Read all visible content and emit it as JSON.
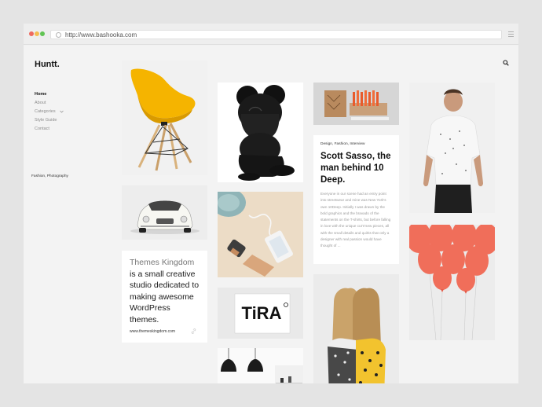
{
  "browser": {
    "url": "http://www.bashooka.com"
  },
  "site": {
    "logo": "Huntt."
  },
  "nav": {
    "items": [
      {
        "label": "Home"
      },
      {
        "label": "About"
      },
      {
        "label": "Categories"
      },
      {
        "label": "Style Guide"
      },
      {
        "label": "Contact"
      }
    ]
  },
  "themes_card": {
    "brand": "Themes Kingdom",
    "text": " is a small creative studio dedicated to making awesome WordPress themes.",
    "link": "www.themeskingdom.com"
  },
  "tira": {
    "logo": "TiRA"
  },
  "post": {
    "tags": "Design, Fashion, Interview",
    "title": "Scott Sasso, the man behind 10 Deep.",
    "excerpt": "Everyone in our scene had an entry point into streetwear and mine was New York's own 10Deep. Initially I was drawn by the bold graphics and the bravado of the statements on the T-shirts, but before falling in love with the unique cut'n'sew pieces, all with the small details and quirks that only a designer with real passion would have thought of ..."
  },
  "photo_post": {
    "tags": "Fashion, Photography"
  },
  "colors": {
    "accent_chair": "#f5b400",
    "balloons": "#f06e5a"
  },
  "icons": [
    "search-icon",
    "menu-icon",
    "globe-icon",
    "chevron-down-icon",
    "link-icon"
  ]
}
